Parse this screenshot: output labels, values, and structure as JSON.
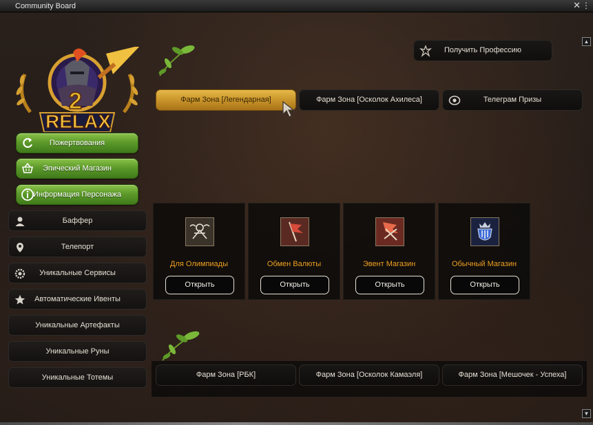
{
  "window": {
    "title": "Community Board",
    "close_label": "✕",
    "more_label": "⋮"
  },
  "sidebar": {
    "green_buttons": [
      {
        "label": "Пожертвования",
        "icon": "refresh-icon"
      },
      {
        "label": "Эпический Магазин",
        "icon": "basket-icon"
      },
      {
        "label": "Информация Персонажа",
        "icon": "info-icon"
      }
    ],
    "items": [
      {
        "label": "Баффер",
        "icon": "user-icon"
      },
      {
        "label": "Телепорт",
        "icon": "location-pin-icon"
      },
      {
        "label": "Уникальные Сервисы",
        "icon": "gear-icon"
      },
      {
        "label": "Автоматические Ивенты",
        "icon": "star-icon"
      },
      {
        "label": "Уникальные Артефакты",
        "icon": ""
      },
      {
        "label": "Уникальные Руны",
        "icon": ""
      },
      {
        "label": "Уникальные Тотемы",
        "icon": ""
      }
    ]
  },
  "logo": {
    "number": "2",
    "text": "RELAX"
  },
  "top": {
    "profession_button": "Получить Профессию",
    "farm_zones_top": [
      {
        "label": "Фарм Зона [Легендарная]",
        "active": true
      },
      {
        "label": "Фарм Зона [Осколок Ахилеса]",
        "active": false
      },
      {
        "label": "Телеграм Призы",
        "active": false
      }
    ]
  },
  "shops": {
    "open_label": "Открыть",
    "cards": [
      {
        "label": "Для Олимпиады",
        "icon": "olympiad-emblem-icon"
      },
      {
        "label": "Обмен Валюты",
        "icon": "flag-icon"
      },
      {
        "label": "Эвент Магазин",
        "icon": "flag-swords-icon"
      },
      {
        "label": "Обычный Магазин",
        "icon": "crown-shield-icon"
      }
    ]
  },
  "bottom": {
    "farm_zones": [
      {
        "label": "Фарм Зона [РБК]"
      },
      {
        "label": "Фарм Зона [Осколок Камаэля]"
      },
      {
        "label": "Фарм Зона [Мешочек - Успеха]"
      }
    ]
  },
  "colors": {
    "green_accent": "#5d9a2a",
    "gold_active": "#c69128",
    "card_label": "#f0a020"
  }
}
